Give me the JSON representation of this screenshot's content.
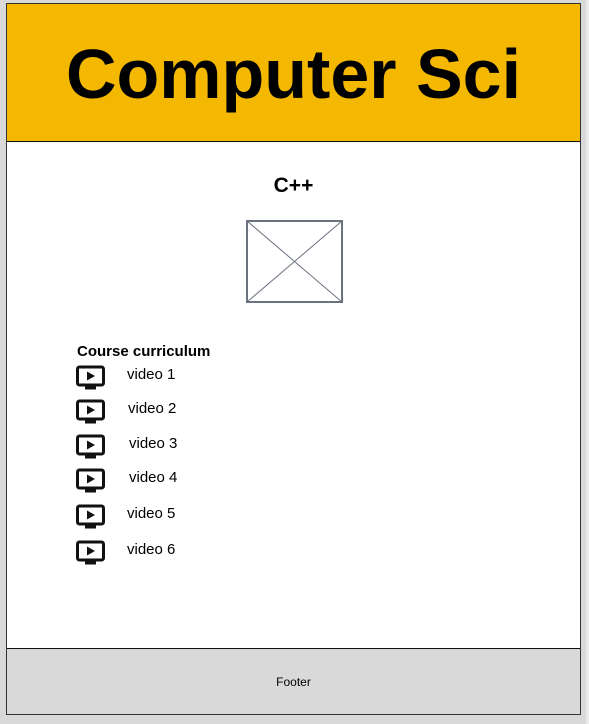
{
  "header": {
    "title": "Computer Sci"
  },
  "course": {
    "title": "C++",
    "thumbnail_icon": "image-placeholder-icon"
  },
  "curriculum": {
    "heading": "Course curriculum",
    "video_icon": "play-video-icon",
    "videos": [
      {
        "label": "video 1"
      },
      {
        "label": "video 2"
      },
      {
        "label": "video 3"
      },
      {
        "label": "video 4"
      },
      {
        "label": "video 5"
      },
      {
        "label": "video 6"
      }
    ]
  },
  "footer": {
    "text": "Footer"
  },
  "colors": {
    "header_bg": "#f4b800",
    "footer_bg": "#d9d9d9",
    "page_bg": "#ffffff"
  }
}
